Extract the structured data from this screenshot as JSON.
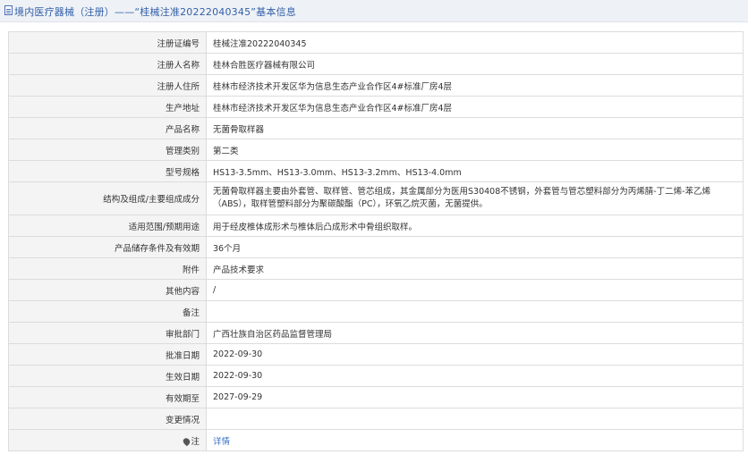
{
  "header": {
    "title": "境内医疗器械（注册）——“桂械注准20222040345”基本信息"
  },
  "rows": [
    {
      "label": "注册证编号",
      "value": "桂械注准20222040345"
    },
    {
      "label": "注册人名称",
      "value": "桂林合胜医疗器械有限公司"
    },
    {
      "label": "注册人住所",
      "value": "桂林市经济技术开发区华为信息生态产业合作区4#标准厂房4层"
    },
    {
      "label": "生产地址",
      "value": "桂林市经济技术开发区华为信息生态产业合作区4#标准厂房4层"
    },
    {
      "label": "产品名称",
      "value": "无菌骨取样器"
    },
    {
      "label": "管理类别",
      "value": "第二类"
    },
    {
      "label": "型号规格",
      "value": "HS13-3.5mm、HS13-3.0mm、HS13-3.2mm、HS13-4.0mm"
    },
    {
      "label": "结构及组成/主要组成成分",
      "value": "无菌骨取样器主要由外套管、取样管、管芯组成，其金属部分为医用S30408不锈钢，外套管与管芯塑料部分为丙烯腈-丁二烯-苯乙烯（ABS），取样管塑料部分为聚碳酸酯（PC），环氧乙烷灭菌，无菌提供。"
    },
    {
      "label": "适用范围/预期用途",
      "value": "用于经皮椎体成形术与椎体后凸成形术中骨组织取样。"
    },
    {
      "label": "产品储存条件及有效期",
      "value": "36个月"
    },
    {
      "label": "附件",
      "value": "产品技术要求"
    },
    {
      "label": "其他内容",
      "value": "/"
    },
    {
      "label": "备注",
      "value": ""
    },
    {
      "label": "审批部门",
      "value": "广西壮族自治区药品监督管理局"
    },
    {
      "label": "批准日期",
      "value": "2022-09-30"
    },
    {
      "label": "生效日期",
      "value": "2022-09-30"
    },
    {
      "label": "有效期至",
      "value": "2027-09-29"
    },
    {
      "label": "变更情况",
      "value": ""
    },
    {
      "label": "注",
      "value": "详情"
    }
  ],
  "icons": {
    "title_icon": "document-icon",
    "note_icon": "pin-icon"
  },
  "colors": {
    "link": "#3a6fc4",
    "title": "#3360a8",
    "label_bg": "#f4f4f4"
  }
}
